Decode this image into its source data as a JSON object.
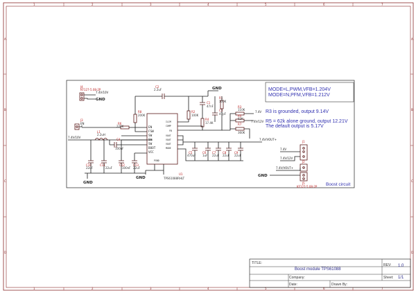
{
  "frame": {
    "columns": [
      "1",
      "2",
      "3",
      "4",
      "5",
      "6",
      "7"
    ],
    "rows": [
      "A",
      "B",
      "C",
      "D"
    ]
  },
  "title_block": {
    "title_label": "TITLE:",
    "title_value": "Boost module TPS61088",
    "rev_label": "REV:",
    "rev_value": "1.0",
    "company_label": "Company:",
    "sheet_label": "Sheet:",
    "sheet_value": "1/1",
    "date_label": "Date:",
    "drawn_label": "Drawn By:"
  },
  "notes": {
    "mode_line1": "MODE=L,PWM,VFB=1.204V",
    "mode_line2": "MODE=N,PFM,VFB=1.212V",
    "r3_note": "R3 is grounded, output 9.14V",
    "r5_note": "R5 = 62k alone ground, output 12.21V",
    "default_note": "The default output is 5.17V",
    "corner_label": "Boost circuit"
  },
  "ic": {
    "ref": "U1",
    "part": "TPS61088RHLT",
    "left_pins": [
      "EN",
      "FSW",
      "SW",
      "SW",
      "SW",
      "BOOT",
      "VCC"
    ],
    "right_pins": [
      "ILIM",
      "COMP",
      "FB",
      "VOUT",
      "VOUT",
      "VOUT",
      "MODE"
    ],
    "bottom_pins": [
      "PGND",
      "PGND",
      "AGND"
    ]
  },
  "components": {
    "r1": {
      "ref": "R1",
      "value": "100K"
    },
    "r2": {
      "ref": "R2",
      "value": "100K"
    },
    "r3": {
      "ref": "R3",
      "value": "110K"
    },
    "r4": {
      "ref": "R4",
      "value": "17.4K"
    },
    "r5": {
      "ref": "R5",
      "value": "62K"
    },
    "r6": {
      "ref": "R6",
      "value": "220K"
    },
    "r7": {
      "ref": "R7",
      "value": "360K"
    },
    "r8": {
      "ref": "R8",
      "value": "200K"
    },
    "l1": {
      "ref": "L1",
      "value": "2.2uH"
    },
    "c1": {
      "ref": "C1",
      "value": "47nF"
    },
    "c2": {
      "ref": "C2",
      "value": "2.2uF"
    },
    "c3": {
      "ref": "C3",
      "value": "47pF"
    },
    "c4": {
      "ref": "C4",
      "value": "100nF"
    },
    "c5": {
      "ref": "C5",
      "value": "470uF"
    },
    "c6": {
      "ref": "C6",
      "value": "1uF"
    },
    "c7": {
      "ref": "C7",
      "value": "22uF"
    },
    "c8": {
      "ref": "C8",
      "value": "22uF"
    },
    "c9": {
      "ref": "C9",
      "value": "22uF"
    },
    "c10": {
      "ref": "C10",
      "value": "22uF"
    },
    "c11": {
      "ref": "C11",
      "value": "22uF"
    },
    "c12": {
      "ref": "C12",
      "value": "100nF"
    },
    "c13": {
      "ref": "C13",
      "value": "22uF"
    }
  },
  "connectors": {
    "j4": {
      "ref": "J4",
      "part": "KF127-5.08-2P",
      "net": "7.4V/10V"
    },
    "j3": {
      "ref": "J3"
    },
    "j1": {
      "ref": "J1"
    },
    "j2": {
      "ref": "J2"
    },
    "j5": {
      "ref": "J5",
      "part": "KF127-5.08-2P"
    }
  },
  "nets": {
    "vin": "7.4V/10V",
    "n9v": "7.4V",
    "n12v": "7.4V/12V",
    "vout": "7.4V/VOUT+",
    "j1_net": "7.4V",
    "j2_net": "7.4V/12V",
    "j5_net": "7.4V/VOUT+",
    "en": "EN",
    "gnd": "GND"
  }
}
